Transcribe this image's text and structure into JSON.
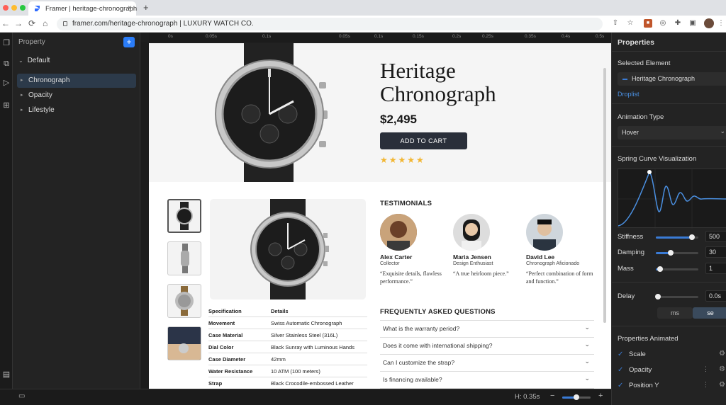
{
  "browser": {
    "tab_title": "Framer | heritage-chronograph",
    "tab_close": "×",
    "new_tab": "+",
    "url": "framer.com/heritage-chronograph | LUXURY WATCH CO.",
    "nav": {
      "back": "←",
      "forward": "→",
      "reload": "⟳",
      "home": "⌂"
    }
  },
  "left_panel": {
    "header": "Property",
    "add_label": "+",
    "default_label": "Default",
    "items": [
      {
        "label": "Chronograph",
        "selected": true
      },
      {
        "label": "Opacity",
        "selected": false
      },
      {
        "label": "Lifestyle",
        "selected": false
      }
    ]
  },
  "ruler": {
    "ticks": [
      "0s",
      "0.05s",
      "0.1s",
      "0.15s",
      "0.2s",
      "0.25s",
      "0.35s",
      "0.4s",
      "0.5s"
    ]
  },
  "product": {
    "title_line1": "Heritage",
    "title_line2": "Chronograph",
    "price": "$2,495",
    "cart_button": "ADD TO CART",
    "stars": "★★★★★",
    "rating": 5
  },
  "specs": {
    "headers": [
      "Specification",
      "Details"
    ],
    "rows": [
      [
        "Movement",
        "Swiss Automatic Chronograph"
      ],
      [
        "Case Material",
        "Silver Stainless Steel (316L)"
      ],
      [
        "Dial Color",
        "Black Sunray with Luminous Hands"
      ],
      [
        "Case Diameter",
        "42mm"
      ],
      [
        "Water Resistance",
        "10 ATM (100 meters)"
      ],
      [
        "Strap",
        "Black Crocodile-embossed Leather"
      ]
    ]
  },
  "testimonials": {
    "title": "TESTIMONIALS",
    "people": [
      {
        "name": "Alex Carter",
        "role": "Collector",
        "quote": "“Exquisite details, flawless performance.”"
      },
      {
        "name": "Maria Jensen",
        "role": "Design Enthusiast",
        "quote": "“A true heirloom piece.”"
      },
      {
        "name": "David Lee",
        "role": "Chronograph Aficionado",
        "quote": "“Perfect combination of form and function.”"
      }
    ]
  },
  "faq": {
    "title": "FREQUENTLY ASKED QUESTIONS",
    "items": [
      "What is the warranty period?",
      "Does it come with international shipping?",
      "Can I customize the strap?",
      "Is financing available?"
    ]
  },
  "bottom_bar": {
    "duration": "H: 0.35s",
    "zoom_out": "−",
    "zoom_in": "+",
    "zoom_level": 0.5
  },
  "right_panel": {
    "title": "Properties",
    "selected_label": "Selected Element",
    "selected_value": "Heritage Chronograph",
    "droplist": "Droplist",
    "animation_type_label": "Animation Type",
    "animation_type_value": "Hover",
    "spring_label": "Spring Curve Visualization",
    "stiffness_label": "Stiffness",
    "stiffness": "500",
    "stiffness_level": 0.85,
    "damping_label": "Damping",
    "damping": "30",
    "damping_level": 0.35,
    "mass_label": "Mass",
    "mass": "1",
    "mass_level": 0.1,
    "delay_label": "Delay",
    "delay": "0.0s",
    "delay_level": 0.05,
    "unit_ms": "ms",
    "unit_se": "se",
    "unit_selected": "se",
    "animated_label": "Properties Animated",
    "animated": [
      "Scale",
      "Opacity",
      "Position Y"
    ]
  },
  "colors": {
    "accent": "#3a7bd5",
    "framer_blue": "#2a7cf7",
    "button_dark": "#2a2f3a",
    "star": "#f2b632"
  }
}
